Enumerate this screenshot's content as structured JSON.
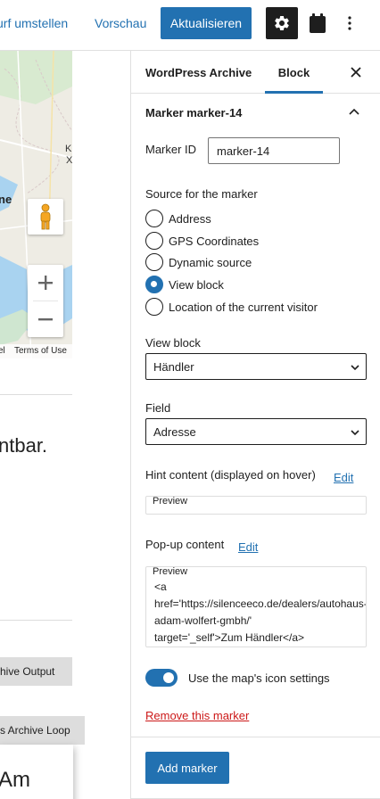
{
  "topbar": {
    "switch_draft": "urf umstellen",
    "preview": "Vorschau",
    "update": "Aktualisieren"
  },
  "editor": {
    "map": {
      "label_bold": "ne",
      "label_small_1": "Kl",
      "label_small_2": "X",
      "footer_left": "el",
      "footer_terms": "Terms of Use"
    },
    "big_text": "ntbar.",
    "tag_archive_output": "hive Output",
    "tag_archive_loop": "s Archive Loop",
    "card_text": "Am"
  },
  "sidebar": {
    "tab_document": "WordPress Archive",
    "tab_block": "Block",
    "panel_title": "Marker marker-14",
    "marker_id_label": "Marker ID",
    "marker_id_value": "marker-14",
    "source_label": "Source for the marker",
    "source_options": [
      {
        "label": "Address",
        "selected": false
      },
      {
        "label": "GPS Coordinates",
        "selected": false
      },
      {
        "label": "Dynamic source",
        "selected": false
      },
      {
        "label": "View block",
        "selected": true
      },
      {
        "label": "Location of the current visitor",
        "selected": false
      }
    ],
    "view_block_label": "View block",
    "view_block_value": "Händler",
    "field_label": "Field",
    "field_value": "Adresse",
    "hint_label": "Hint content (displayed on hover)",
    "hint_edit": "Edit",
    "hint_preview_legend": "Preview",
    "popup_label": "Pop-up content",
    "popup_edit": "Edit",
    "popup_preview_legend": "Preview",
    "popup_preview_content": "<a\nhref='https://silenceeco.de/dealers/autohaus-\nadam-wolfert-gmbh/'\ntarget='_self'>Zum Händler</a>",
    "toggle_label": "Use the map's icon settings",
    "toggle_on": true,
    "remove_marker": "Remove this marker",
    "add_marker": "Add marker"
  },
  "colors": {
    "accent": "#2271b1",
    "danger": "#cc1818",
    "dark": "#1e1e1e"
  }
}
